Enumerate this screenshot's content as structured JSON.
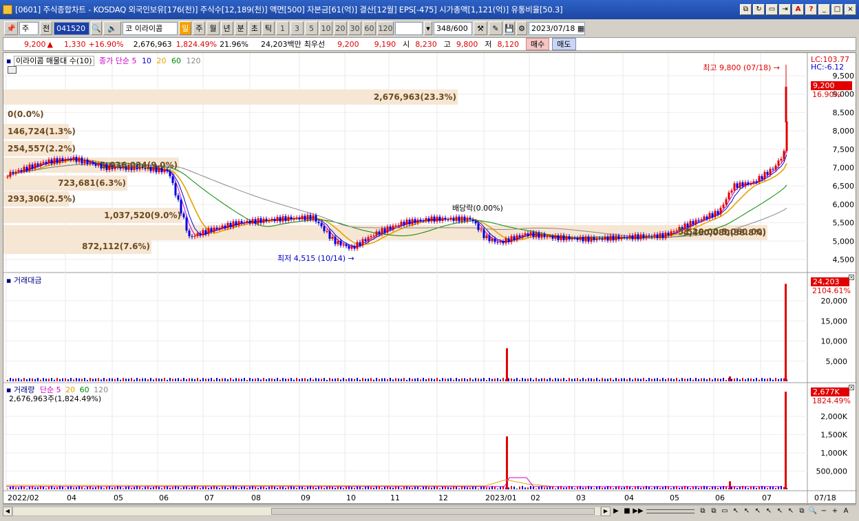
{
  "window": {
    "title": "[0601] 주식종합차트 - KOSDAQ 외국인보유[176(천)] 주식수[12,189(천)] 액면[500] 자본금[61(억)] 결산[12월] EPS[-475] 시가총액[1,121(억)] 유통비율[50.3]",
    "buttons": [
      "⧉",
      "↻",
      "▭",
      "⇥",
      "A",
      "?",
      "_",
      "□",
      "×"
    ]
  },
  "toolbar": {
    "market_select": "주",
    "prev_label": "전",
    "code": "041520",
    "stock_type": "코",
    "stock_name": "이라이콤",
    "periods": [
      "일",
      "주",
      "월",
      "년",
      "분",
      "초",
      "틱"
    ],
    "selected_period": "일",
    "intervals": [
      "1",
      "3",
      "5",
      "10",
      "20",
      "30",
      "60",
      "120"
    ],
    "count": "348",
    "count_max": "/600",
    "date": "2023/07/18"
  },
  "quote": {
    "price": "9,200",
    "change_arrow": "▲",
    "change": "1,330",
    "change_pct": "+16.90%",
    "volume": "2,676,963",
    "volume_pct": "1,824.49%",
    "turnover": "21.96%",
    "trade_value": "24,203백만",
    "best_label": "최우선",
    "ask": "9,200",
    "bid": "9,190",
    "open_label": "시",
    "open": "8,230",
    "high_label": "고",
    "high": "9,800",
    "low_label": "저",
    "low": "8,120",
    "buy_label": "매수",
    "sell_label": "매도"
  },
  "price_panel": {
    "legend": "이라이콤 매물대 수(10)",
    "ma_title": "종가 단순 5",
    "ma_periods": [
      "10",
      "20",
      "60",
      "120"
    ],
    "ma_colors": {
      "5": "#cc00cc",
      "10": "#0000cc",
      "20": "#e6a000",
      "60": "#008800",
      "120": "#888888"
    },
    "lc": "LC:103.77",
    "hc": "HC:-6.12",
    "last_price": "9,200",
    "last_pct": "16.90%",
    "high_annotation": "최고 9,800 (07/18)",
    "low_annotation": "최저 4,515 (10/14)",
    "dividend_annotation": "배당락(0.00%)",
    "yticks": [
      "9,500",
      "9,000",
      "8,500",
      "8,000",
      "7,500",
      "7,000",
      "6,500",
      "6,000",
      "5,500",
      "5,000",
      "4,500"
    ],
    "volume_profile": [
      {
        "label": "2,676,963(23.3%)"
      },
      {
        "label": "0(0.0%)"
      },
      {
        "label": "146,724(1.3%)"
      },
      {
        "label": "254,557(2.2%)"
      },
      {
        "label": "1,036,034(9.0%)"
      },
      {
        "label": "723,681(6.3%)"
      },
      {
        "label": "293,306(2.5%)"
      },
      {
        "label": "1,037,520(9.0%)"
      },
      {
        "label": "4,460,080(38.8%)"
      },
      {
        "label": "872,112(7.6%)"
      }
    ],
    "ma_lastvals": "5,520.00  5,060.00)"
  },
  "amount_panel": {
    "legend": "거래대금",
    "last_value": "24,203",
    "last_pct": "2104.61%",
    "yticks": [
      "20,000",
      "15,000",
      "10,000",
      "5,000"
    ]
  },
  "volume_panel": {
    "legend": "거래량",
    "ma_title": "단순 5",
    "ma_periods": [
      "20",
      "60",
      "120"
    ],
    "info": "2,676,963주(1,824.49%)",
    "last_value": "2,677K",
    "last_pct": "1824.49%",
    "yticks": [
      "2,000K",
      "1,500K",
      "1,000K",
      "500,000"
    ]
  },
  "xaxis": {
    "labels": [
      "2022/02",
      "04",
      "05",
      "06",
      "07",
      "08",
      "09",
      "10",
      "11",
      "12",
      "2023/01",
      "02",
      "03",
      "04",
      "05",
      "06",
      "07"
    ],
    "last": "07/18"
  }
}
